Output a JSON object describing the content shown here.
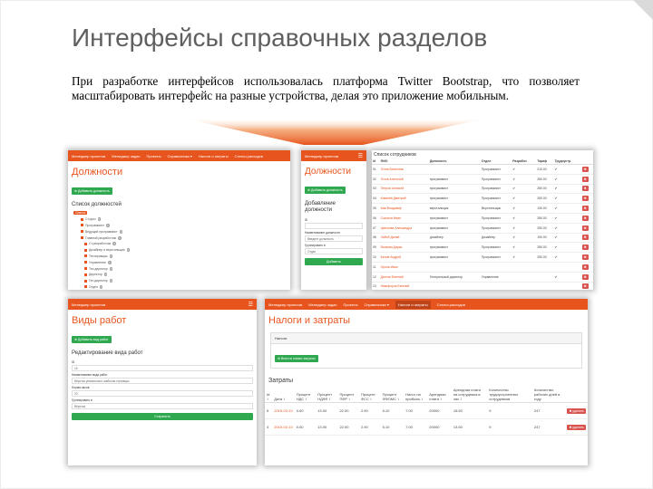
{
  "slide": {
    "title": "Интерфейсы справочных разделов",
    "description": "При разработке интерфейсов использовалась платформа Twitter Bootstrap, что позволяет масштабировать интерфейс на разные устройства, делая это приложение мобильным.",
    "accent_color": "#e8541e",
    "success_color": "#2fa84f",
    "danger_color": "#d9534f"
  },
  "shot1": {
    "nav": [
      "Менеджер проектов",
      "Менеджер задач",
      "Проекты",
      "Справочники ▾",
      "Налоги и затраты",
      "Статьи расходов"
    ],
    "heading": "Должности",
    "add_btn": "⊕ Добавить должность",
    "list_title": "Список должностей",
    "tree": [
      {
        "label": "Список",
        "badge": "",
        "root": true
      },
      {
        "label": "Ст.руко",
        "badge": "0"
      },
      {
        "label": "Программист",
        "badge": "0"
      },
      {
        "label": "Ведущий программист",
        "badge": "0"
      },
      {
        "label": "Главный разработчик",
        "badge": "0"
      },
      {
        "label": "Ст.разработчик",
        "badge": "0"
      },
      {
        "label": "Дизайнер и верстальщик",
        "badge": "0"
      },
      {
        "label": "Тестировщик",
        "badge": "0"
      },
      {
        "label": "Управление",
        "badge": "0"
      },
      {
        "label": "Тех.директор",
        "badge": "0"
      },
      {
        "label": "Директор",
        "badge": "0"
      },
      {
        "label": "Ген.директор",
        "badge": "0"
      },
      {
        "label": "Отдел",
        "badge": "0"
      }
    ]
  },
  "shot2": {
    "nav_brand": "Менеджер проектов",
    "burger": "☰",
    "heading": "Должности",
    "add_btn": "⊕ Добавить должность",
    "form_title": "Добавление должности",
    "id_label": "ID",
    "id_placeholder": "",
    "name_label": "Наименование должности",
    "name_placeholder": "Введите должность",
    "group_label": "Группировать в",
    "group_value": "Отдел",
    "submit": "Добавить"
  },
  "shot3": {
    "title": "Список сотрудников",
    "headers": [
      "id",
      "ФИО",
      "Должность",
      "Отдел",
      "Разработ.",
      "Тариф",
      "Трудоустр.",
      ""
    ],
    "rows": [
      {
        "id": "01",
        "name": "Титов Вячеслав",
        "pos": "",
        "dept": "Программист",
        "chk": "✔",
        "rate": "210.00",
        "emp": "✔",
        "del": "✖"
      },
      {
        "id": "02",
        "name": "Титов Анатолий",
        "pos": "программист",
        "dept": "Программист",
        "chk": "✔",
        "rate": "280.00",
        "emp": "✔",
        "del": "✖"
      },
      {
        "id": "03",
        "name": "Петров Алексей",
        "pos": "программист",
        "dept": "Программист",
        "chk": "✔",
        "rate": "280.00",
        "emp": "✔",
        "del": "✖"
      },
      {
        "id": "04",
        "name": "Ковалёв Дмитрий",
        "pos": "программист",
        "dept": "Программист",
        "chk": "✔",
        "rate": "260.00",
        "emp": "✔",
        "del": "✖"
      },
      {
        "id": "05",
        "name": "Ким Владимир",
        "pos": "верстальщик",
        "dept": "Верстальщик",
        "chk": "✔",
        "rate": "130.00",
        "emp": "✔",
        "del": "✖"
      },
      {
        "id": "06",
        "name": "Соколов Иван",
        "pos": "программист",
        "dept": "Программист",
        "chk": "✔",
        "rate": "280.00",
        "emp": "✔",
        "del": "✖"
      },
      {
        "id": "07",
        "name": "Цветкова Александра",
        "pos": "программист",
        "dept": "Программист",
        "chk": "✔",
        "rate": "250.00",
        "emp": "✔",
        "del": "✖"
      },
      {
        "id": "08",
        "name": "Хабиб Далай",
        "pos": "дизайнер",
        "dept": "Дизайнер",
        "chk": "✔",
        "rate": "190.00",
        "emp": "✔",
        "del": "✖"
      },
      {
        "id": "09",
        "name": "Волкова Дарья",
        "pos": "программист",
        "dept": "Программист",
        "chk": "✔",
        "rate": "280.00",
        "emp": "✔",
        "del": "✖"
      },
      {
        "id": "10",
        "name": "Белов Андрей",
        "pos": "программист",
        "dept": "Программист",
        "chk": "✔",
        "rate": "250.00",
        "emp": "✔",
        "del": "✖"
      },
      {
        "id": "11",
        "name": "Орлов Иван",
        "pos": "",
        "dept": "",
        "chk": "",
        "rate": "",
        "emp": "",
        "del": "✖"
      },
      {
        "id": "12",
        "name": "Дятлов Евгений",
        "pos": "Генеральный директор",
        "dept": "Управление",
        "chk": "",
        "rate": "",
        "emp": "✔",
        "del": "✖"
      },
      {
        "id": "13",
        "name": "Никифоров Евгений",
        "pos": "",
        "dept": "",
        "chk": "",
        "rate": "",
        "emp": "",
        "del": "✖"
      }
    ]
  },
  "shot4": {
    "nav_brand": "Менеджер проектов",
    "burger": "☰",
    "heading": "Виды работ",
    "add_btn": "⊕ Добавить вид работ",
    "form_title": "Редактирование вида работ",
    "id_label": "ID",
    "id_value": "15",
    "name_label": "Наименование вида работ",
    "name_value": "Вёрстка уникального шаблона страницы",
    "hours_label": "Норма-часов",
    "hours_value": "20",
    "group_label": "Группировать в",
    "group_value": "Вёрстка",
    "submit": "Сохранить"
  },
  "shot5": {
    "nav": [
      "Менеджер проектов",
      "Менеджер задач",
      "Проекты",
      "Справочники ▾",
      "Налоги и затраты",
      "Статьи расходов"
    ],
    "heading": "Налоги и затраты",
    "panel_title": "Налоги",
    "panel_btn": "⊕ Внести новые затраты",
    "sub_title": "Затраты",
    "headers": [
      "Id ↕",
      "Дата ↕",
      "Процент НДС ↕",
      "Процент НДФЛ ↕",
      "Процент ПФР ↕",
      "Процент ФСС ↕",
      "Процент ФФОМС ↕",
      "Налог на прибыль ↕",
      "Арендная плата ↕",
      "Арендная плата на сотрудника в час ↕",
      "Количество трудоустроенных сотрудников",
      "Количество рабочих дней в году",
      ""
    ],
    "rows": [
      {
        "id": "5",
        "date": "2015-02-10",
        "nds": "0.00",
        "ndfl": "13.00",
        "pfr": "22.00",
        "fss": "2.90",
        "ffoms": "5.10",
        "tax": "7.00",
        "rent": "20000",
        "rent_hour": "15.50",
        "emp": "9",
        "days": "247",
        "del": "✖ удалить"
      },
      {
        "id": "4",
        "date": "2015-02-10",
        "nds": "0.00",
        "ndfl": "13.00",
        "pfr": "22.00",
        "fss": "2.90",
        "ffoms": "5.10",
        "tax": "7.00",
        "rent": "20000",
        "rent_hour": "13.50",
        "emp": "9",
        "days": "247",
        "del": "✖ удалить"
      }
    ]
  }
}
